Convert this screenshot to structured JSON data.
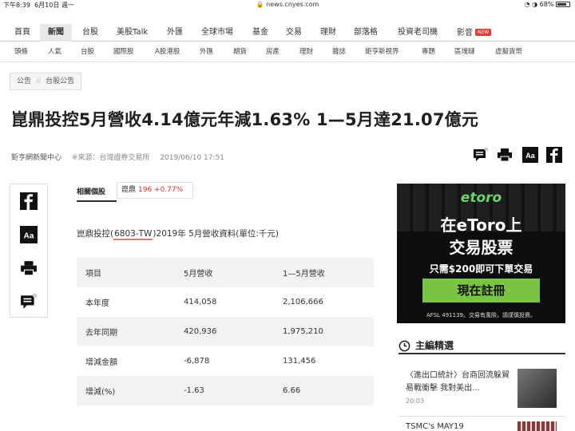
{
  "status": {
    "time": "下午8:39",
    "date": "6月10日 週一",
    "url": "news.cnyes.com",
    "battery": "68%"
  },
  "topnav": [
    "首頁",
    "新聞",
    "台股",
    "美股Talk",
    "外匯",
    "全球市場",
    "基金",
    "交易",
    "理財",
    "部落格",
    "投資老司機",
    "影音"
  ],
  "topnav_active": "新聞",
  "topnav_badge": "NEW",
  "subnav": [
    "頭條",
    "人氣",
    "台股",
    "國際股",
    "A股港股",
    "外匯",
    "期貨",
    "房產",
    "理財",
    "雜誌",
    "鉅亨新視界",
    "專題",
    "區塊鏈",
    "虛擬貨幣"
  ],
  "breadcrumb": [
    "公告",
    "台股公告"
  ],
  "headline": "崑鼎投控5月營收4.14億元年減1.63% 1—5月達21.07億元",
  "meta": {
    "author": "鉅亨網新聞中心",
    "source": "※來源：台灣證券交易所",
    "datetime": "2019/06/10 17:51"
  },
  "related": {
    "label": "相關個股",
    "stock_name": "崑鼎",
    "stock_price": "196 +0.77%"
  },
  "intro": {
    "prefix": "崑鼎投控(",
    "code": "6803-TW",
    "suffix": ")2019年 5月營收資料(單位:千元)"
  },
  "table": {
    "headers": [
      "項目",
      "5月營收",
      "1—5月營收"
    ],
    "rows": [
      [
        "本年度",
        "414,058",
        "2,106,666"
      ],
      [
        "去年同期",
        "420,936",
        "1,975,210"
      ],
      [
        "增減金額",
        "-6,878",
        "131,456"
      ],
      [
        "增減(%)",
        "-1.63",
        "6.66"
      ]
    ]
  },
  "ad": {
    "logo": "etoro",
    "line1": "在eToro上",
    "line2": "交易股票",
    "line3": "只需$200即可下單交易",
    "button": "現在註冊",
    "footer": "AFSL 491139。交易有風險，請謹慎投資。"
  },
  "editor": {
    "title": "主編精選",
    "news1": "〈進出口統計〉台商回流躲貿易戰衝擊 我對美出...",
    "news1_time": "20:03",
    "news2": "TSMC's MAY19"
  }
}
